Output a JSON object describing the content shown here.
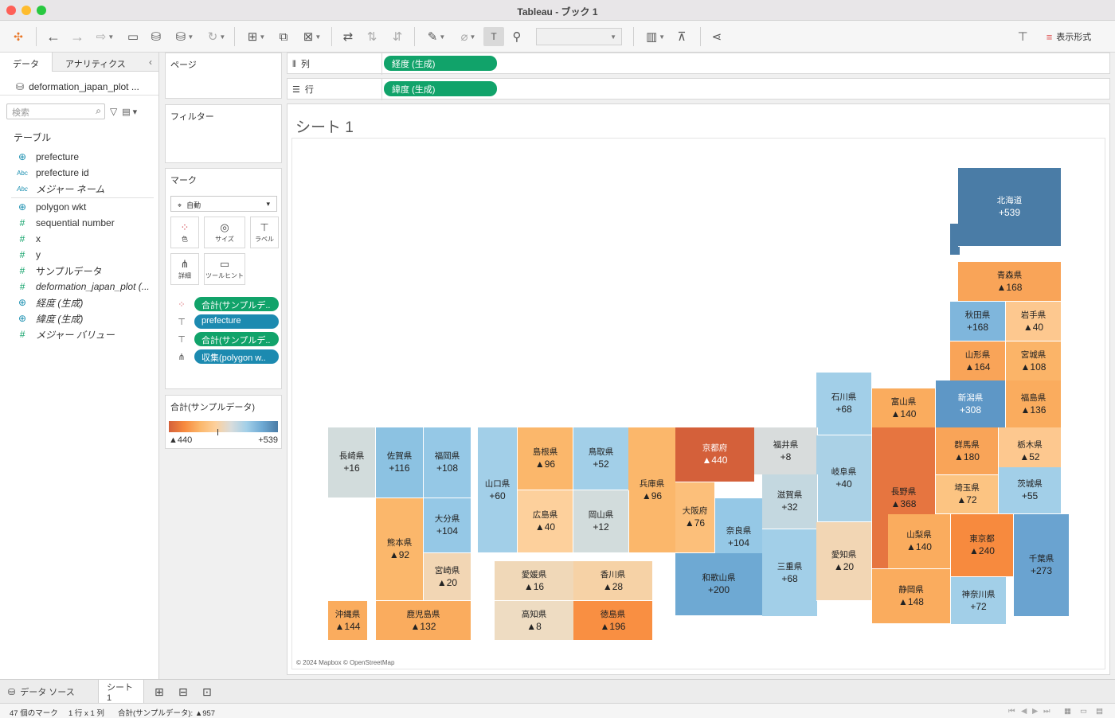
{
  "window": {
    "title": "Tableau - ブック 1"
  },
  "toolbar": {
    "show_me_label": "表示形式",
    "icons": [
      "tableau-logo-icon",
      "back-icon",
      "forward-icon",
      "redo-icon",
      "save-icon",
      "new-datasource-icon",
      "pause-icon",
      "refresh-icon",
      "new-worksheet-icon",
      "duplicate-icon",
      "clear-icon",
      "swap-icon",
      "sort-asc-icon",
      "sort-desc-icon",
      "highlight-icon",
      "group-icon",
      "label-icon",
      "pin-icon",
      "fit-dropdown",
      "show-cards-icon",
      "presentation-icon",
      "share-icon"
    ]
  },
  "left_pane": {
    "tabs": {
      "data": "データ",
      "analytics": "アナリティクス"
    },
    "datasource_name": "deformation_japan_plot ...",
    "search_placeholder": "検索",
    "section_tables": "テーブル",
    "fields": [
      {
        "name": "prefecture",
        "type": "geo",
        "italic": false
      },
      {
        "name": "prefecture id",
        "type": "abc",
        "italic": false
      },
      {
        "name": "メジャー ネーム",
        "type": "abc",
        "italic": true
      },
      {
        "name": "polygon wkt",
        "type": "geo",
        "italic": false
      },
      {
        "name": "sequential number",
        "type": "num",
        "italic": false
      },
      {
        "name": "x",
        "type": "num",
        "italic": false
      },
      {
        "name": "y",
        "type": "num",
        "italic": false
      },
      {
        "name": "サンプルデータ",
        "type": "num",
        "italic": false
      },
      {
        "name": "deformation_japan_plot (...",
        "type": "num",
        "italic": true
      },
      {
        "name": "経度 (生成)",
        "type": "geo",
        "italic": true
      },
      {
        "name": "緯度 (生成)",
        "type": "geo",
        "italic": true
      },
      {
        "name": "メジャー バリュー",
        "type": "num",
        "italic": true
      }
    ]
  },
  "cards": {
    "pages_title": "ページ",
    "filters_title": "フィルター",
    "marks_title": "マーク",
    "mark_type": "自動",
    "mark_buttons": {
      "color": "色",
      "size": "サイズ",
      "label": "ラベル",
      "detail": "詳細",
      "tooltip": "ツールヒント"
    },
    "mark_pills": [
      {
        "kind": "color",
        "label": "合計(サンプルデ..",
        "color": "green"
      },
      {
        "kind": "label",
        "label": "prefecture",
        "color": "blue"
      },
      {
        "kind": "label",
        "label": "合計(サンプルデ..",
        "color": "green"
      },
      {
        "kind": "detail",
        "label": "収集(polygon w..",
        "color": "blue"
      }
    ],
    "legend_title": "合計(サンプルデータ)",
    "legend_min": "▲440",
    "legend_max": "+539"
  },
  "shelves": {
    "columns_label": "列",
    "columns_pill": "経度 (生成)",
    "rows_label": "行",
    "rows_pill": "緯度 (生成)"
  },
  "view": {
    "sheet_title": "シート 1",
    "attribution": "© 2024 Mapbox © OpenStreetMap"
  },
  "prefectures": [
    {
      "name": "北海道",
      "value": "+539",
      "color": "#4a7ca6"
    },
    {
      "name": "青森県",
      "value": "▲168",
      "color": "#f9a458"
    },
    {
      "name": "秋田県",
      "value": "+168",
      "color": "#7fb6dc"
    },
    {
      "name": "岩手県",
      "value": "▲40",
      "color": "#fdc88f"
    },
    {
      "name": "山形県",
      "value": "▲164",
      "color": "#f9a458"
    },
    {
      "name": "宮城県",
      "value": "▲108",
      "color": "#fbb468"
    },
    {
      "name": "石川県",
      "value": "+68",
      "color": "#a2cfe8"
    },
    {
      "name": "富山県",
      "value": "▲140",
      "color": "#faac5e"
    },
    {
      "name": "新潟県",
      "value": "+308",
      "color": "#5e97c6"
    },
    {
      "name": "福島県",
      "value": "▲136",
      "color": "#faac5e"
    },
    {
      "name": "長崎県",
      "value": "+16",
      "color": "#d2dcdc"
    },
    {
      "name": "佐賀県",
      "value": "+116",
      "color": "#8cc2e2"
    },
    {
      "name": "福岡県",
      "value": "+108",
      "color": "#95c8e6"
    },
    {
      "name": "山口県",
      "value": "+60",
      "color": "#a2cfe8"
    },
    {
      "name": "島根県",
      "value": "▲96",
      "color": "#fbb76b"
    },
    {
      "name": "鳥取県",
      "value": "+52",
      "color": "#a2cfe8"
    },
    {
      "name": "兵庫県",
      "value": "▲96",
      "color": "#fbb76b"
    },
    {
      "name": "京都府",
      "value": "▲440",
      "color": "#d4603a"
    },
    {
      "name": "福井県",
      "value": "+8",
      "color": "#d8dcdc"
    },
    {
      "name": "岐阜県",
      "value": "+40",
      "color": "#aad1e6"
    },
    {
      "name": "長野県",
      "value": "▲368",
      "color": "#e67540"
    },
    {
      "name": "群馬県",
      "value": "▲180",
      "color": "#f9a458"
    },
    {
      "name": "栃木県",
      "value": "▲52",
      "color": "#fdc88f"
    },
    {
      "name": "茨城県",
      "value": "+55",
      "color": "#a2cfe8"
    },
    {
      "name": "大分県",
      "value": "+104",
      "color": "#95c8e6"
    },
    {
      "name": "熊本県",
      "value": "▲92",
      "color": "#fbb76b"
    },
    {
      "name": "広島県",
      "value": "▲40",
      "color": "#fdd09c"
    },
    {
      "name": "岡山県",
      "value": "+12",
      "color": "#d2dcdc"
    },
    {
      "name": "大阪府",
      "value": "▲76",
      "color": "#fcbf7a"
    },
    {
      "name": "奈良県",
      "value": "+104",
      "color": "#95c8e6"
    },
    {
      "name": "滋賀県",
      "value": "+32",
      "color": "#c4d8e0"
    },
    {
      "name": "埼玉県",
      "value": "▲72",
      "color": "#fcc482"
    },
    {
      "name": "宮崎県",
      "value": "▲20",
      "color": "#f2d6b4"
    },
    {
      "name": "山梨県",
      "value": "▲140",
      "color": "#faac5e"
    },
    {
      "name": "東京都",
      "value": "▲240",
      "color": "#f78a3e"
    },
    {
      "name": "千葉県",
      "value": "+273",
      "color": "#6aa3d0"
    },
    {
      "name": "愛媛県",
      "value": "▲16",
      "color": "#f0d8b8"
    },
    {
      "name": "香川県",
      "value": "▲28",
      "color": "#f6d2a6"
    },
    {
      "name": "和歌山県",
      "value": "+200",
      "color": "#6ea9d3"
    },
    {
      "name": "三重県",
      "value": "+68",
      "color": "#a2cfe8"
    },
    {
      "name": "愛知県",
      "value": "▲20",
      "color": "#f2d6b4"
    },
    {
      "name": "沖縄県",
      "value": "▲144",
      "color": "#faac5e"
    },
    {
      "name": "鹿児島県",
      "value": "▲132",
      "color": "#faac5e"
    },
    {
      "name": "高知県",
      "value": "▲8",
      "color": "#eedcc2"
    },
    {
      "name": "徳島県",
      "value": "▲196",
      "color": "#f98f42"
    },
    {
      "name": "静岡県",
      "value": "▲148",
      "color": "#faac5e"
    },
    {
      "name": "神奈川県",
      "value": "+72",
      "color": "#a2cfe8"
    }
  ],
  "bottom": {
    "datasource_tab": "データ ソース",
    "sheet_tab": "シート 1"
  },
  "status": {
    "marks": "47 個のマーク",
    "dims": "1 行 x 1 列",
    "sum": "合計(サンプルデータ): ▲957"
  }
}
